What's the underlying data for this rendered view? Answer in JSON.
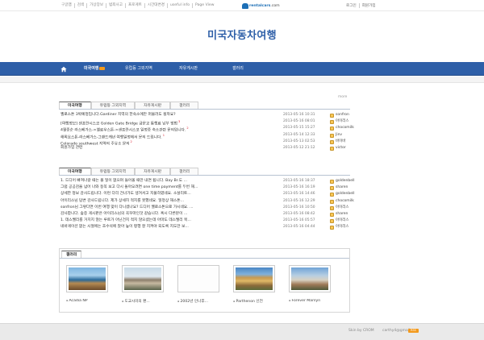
{
  "top": {
    "links": [
      "구글맵",
      "검색",
      "가상장보",
      "범죄사고",
      "프로게트",
      "시간대변경",
      "useful info",
      "Page View"
    ],
    "logo_text": "rentalcars",
    "logo_suffix": ".com",
    "login": "로그인",
    "signup": "회원가입"
  },
  "site": {
    "title": "미국자동차여행"
  },
  "nav": {
    "items": [
      "미국여행",
      "유럽등 그외지역",
      "자유게시판",
      "갤러리"
    ],
    "active_index": 0
  },
  "more": "more",
  "box1": {
    "tabs": [
      "미국여행",
      "유럽등 그외지역",
      "자유게시판",
      "갤러리"
    ],
    "rows": [
      {
        "title": "옐로스톤 3박예정입니다.Gardiner 지역의 한숙소에만 머물러도 될까요?",
        "count": "",
        "date": "2013-05-16 10:31",
        "user": "sonfron"
      },
      {
        "title": "[여행정보] 샌프란시스코 Golden Gate Bridge 금문교 통행료 납부 방법",
        "count": "3",
        "date": "2013-05-16 08:01",
        "user": "아이리스"
      },
      {
        "title": "4월중순 라스베가스->옐로우스톤->샌프란시스코 일정중 숙소관련 문의입니다.",
        "count": "2",
        "date": "2013-05-15 15:27",
        "user": "chocomilk"
      },
      {
        "title": "해외요스톤-라스베가스-그랜드캐년 여행일정에서 문의 드립니다.",
        "count": "1",
        "date": "2013-05-14 12:33",
        "user": "Jinv"
      },
      {
        "title": "Colorado southwest 지역의 주유소 문의",
        "count": "2",
        "date": "2013-05-13 02:53",
        "user": "바이바"
      },
      {
        "title": "회원가입 관련",
        "count": "",
        "date": "2013-05-12 21:12",
        "user": "victor"
      }
    ]
  },
  "box2": {
    "tabs": [
      "미국여행",
      "유럽등 그외지역",
      "자유게시판",
      "갤러리"
    ],
    "rows": [
      {
        "title": "1. 드디어 빠져나갈 때는 볼 일이 없으며 들어올 때만 내면 됩니다. Bay Br.도 ...",
        "date": "2013-05-16 18:37",
        "user": "goldenbell"
      },
      {
        "title": "그럼 공공감을 넘어 나와 동쪽 보고 다시 돌아오려면 one time payment를 두번 해...",
        "date": "2013-05-16 16:19",
        "user": "sharen"
      },
      {
        "title": "상세한 정보 감사드립니다. 이런 다리 건너가도 생겨서고 지불하였네요. 소살리토...",
        "date": "2013-05-16 14:46",
        "user": "goldenbell"
      },
      {
        "title": "아이리스님 답변 감사드립니다. 제가 상세히 적지를 못했네요. 일정상 해스톤...",
        "date": "2013-05-16 12:29",
        "user": "chocomilk"
      },
      {
        "title": "sonfron님 그렇다면 이번 여행 맞이 다니셨나요? 드디어 옐로스톤으로 가시네요. ...",
        "date": "2013-05-16 10:50",
        "user": "아이리스"
      },
      {
        "title": "감사합니다. 숲중 게시판은 아이리스님의 꼭꾸마인것 같습니다. 혹시 다른분이 ...",
        "date": "2013-05-16 08:42",
        "user": "sharen"
      },
      {
        "title": "1. 데스밸리를 거치지 않는 루트가 아닌건지 적지 않으셨는데 아마도 데스밸리 북...",
        "date": "2013-05-16 05:57",
        "user": "아이리스"
      },
      {
        "title": "네바게이션 없는 시절에는 조수석에 앉아 높이 평행 잘 지켜야 되도록 지도만 보...",
        "date": "2013-05-16 04:44",
        "user": "아이리스"
      }
    ]
  },
  "gallery": {
    "tab": "갤러리",
    "items": [
      {
        "caption": "Acadia NP"
      },
      {
        "caption": "도교시미의 편..."
      },
      {
        "caption": "2002년 인나후..."
      },
      {
        "caption": "Parthenon 신전"
      },
      {
        "caption": "Forever Marilyn"
      }
    ]
  },
  "footer": {
    "skin": "Skin by CROM",
    "email": "carthy4@gmail.com",
    "rss": "RSS"
  },
  "colors": {
    "brand": "#2e5fa8",
    "nav_badge": "#f49a1d",
    "count": "#dd2233"
  }
}
